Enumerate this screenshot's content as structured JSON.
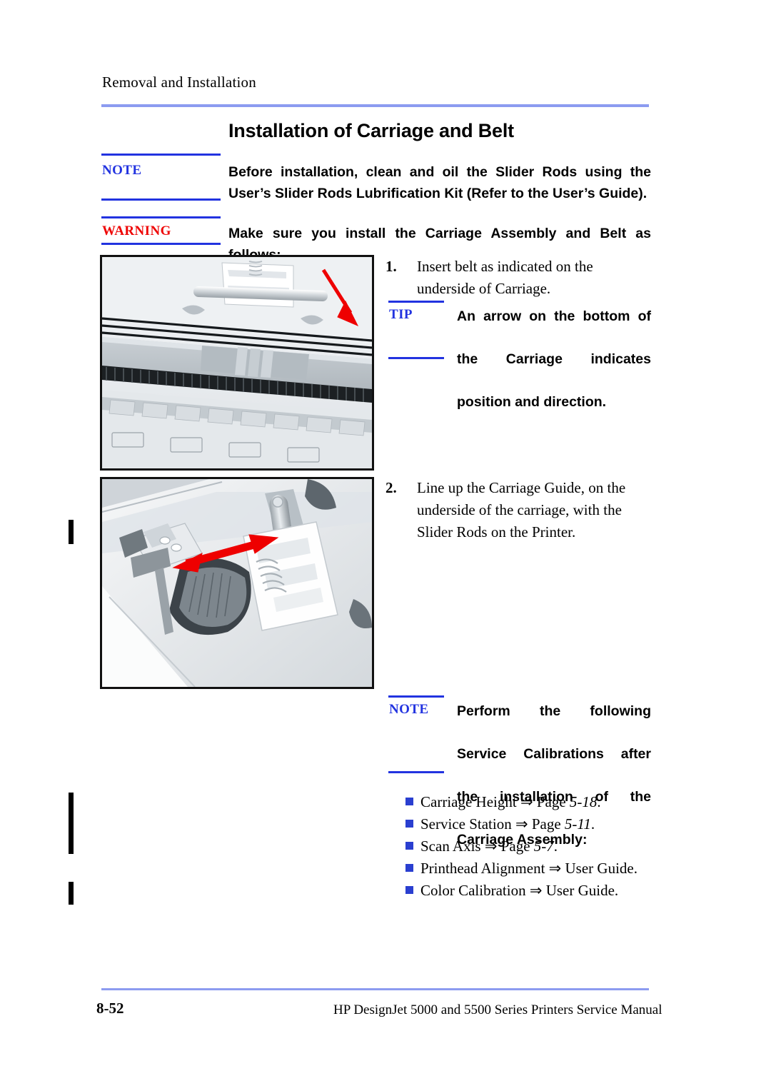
{
  "header": {
    "running_head": "Removal and Installation"
  },
  "section": {
    "title": "Installation of Carriage and Belt"
  },
  "note_top": {
    "label": "NOTE",
    "line1": "Before installation, clean and oil the Slider Rods using the User’s",
    "line2": "Slider Rods Lubrification Kit (Refer to the User’s Guide)."
  },
  "warning": {
    "label": "WARNING",
    "line1": "Make sure you install the Carriage Assembly and Belt as follows:"
  },
  "steps": [
    {
      "number": "1.",
      "line1": "Insert belt as indicated on the",
      "line2": "underside of Carriage."
    },
    {
      "number": "2.",
      "line1": "Line up the Carriage Guide, on the",
      "line2": "underside of the carriage, with the",
      "line3": "Slider Rods on the Printer."
    }
  ],
  "tip": {
    "label": "TIP",
    "line1": "An arrow on the bottom of",
    "line2": "the Carriage indicates",
    "line3": "position and direction."
  },
  "note_bottom": {
    "label": "NOTE",
    "line1": "Perform the following",
    "line2": "Service Calibrations after",
    "line3": "the installation of the",
    "line4": "Carriage Assembly:"
  },
  "calibrations": [
    {
      "name": "Carriage Height",
      "arrow": "⇒",
      "target": "Page",
      "page": "5-18",
      "period": "."
    },
    {
      "name": "Service Station",
      "arrow": "⇒",
      "target": "Page",
      "page": "5-11",
      "period": "."
    },
    {
      "name": "Scan Axis",
      "arrow": "⇒",
      "target": "Page",
      "page": "5-7",
      "period": "."
    },
    {
      "name": "Printhead Alignment",
      "arrow": "⇒",
      "target": "User Guide",
      "page": "",
      "period": "."
    },
    {
      "name": "Color Calibration",
      "arrow": "⇒",
      "target": "User Guide",
      "page": "",
      "period": "."
    }
  ],
  "figures": [
    {
      "caption": "carriage-belt-insertion-photo",
      "annotation": "red-down-arrow"
    },
    {
      "caption": "carriage-guide-slider-rod-photo",
      "annotation": "red-double-arrow"
    }
  ],
  "footer": {
    "page_number": "8-52",
    "manual_title": "HP DesignJet 5000 and 5500 Series Printers Service Manual"
  },
  "colors": {
    "rule_light_blue": "#8c9bf0",
    "admonition_blue": "#2233e0",
    "warning_red": "#ee0505",
    "bullet_blue": "#2a3fd0"
  }
}
